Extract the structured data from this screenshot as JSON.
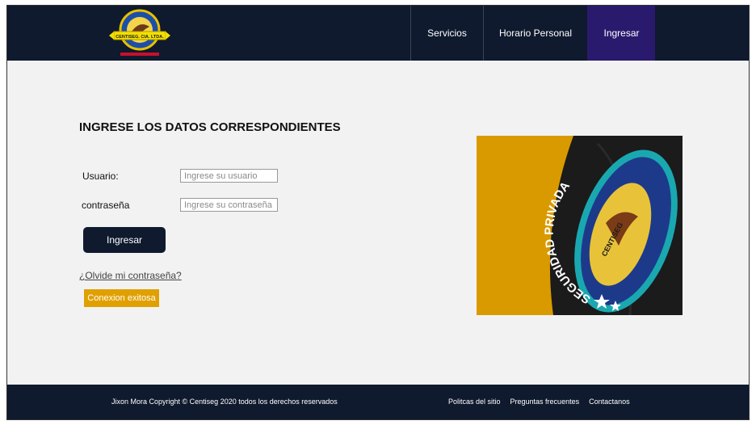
{
  "nav": {
    "items": [
      {
        "label": "Servicios"
      },
      {
        "label": "Horario Personal"
      },
      {
        "label": "Ingresar"
      }
    ],
    "active": "Ingresar"
  },
  "logo": {
    "text": "CENTISEG. CIA. LTDA."
  },
  "login": {
    "title": "INGRESE LOS DATOS CORRESPONDIENTES",
    "user_label": "Usuario:",
    "user_placeholder": "Ingrese su usuario",
    "password_label": "contraseña",
    "password_placeholder": "Ingrese su contraseña",
    "submit_label": "Ingresar",
    "forgot_label": "¿Olvide mi contraseña?",
    "status": "Conexion exitosa"
  },
  "hero": {
    "patch_text": "SEGURIDAD PRIVADA",
    "patch_center": "CENTISEG"
  },
  "footer": {
    "copyright": "Jixon Mora Copyright © Centiseg 2020 todos los derechos reservados",
    "links": [
      {
        "label": "Politcas del sitio"
      },
      {
        "label": "Preguntas frecuentes"
      },
      {
        "label": "Contactanos"
      }
    ]
  },
  "colors": {
    "header_bg": "#0f1a2e",
    "nav_active_bg": "#2a1a6e",
    "status_bg": "#e0a000",
    "page_bg": "#f2f2f2"
  }
}
